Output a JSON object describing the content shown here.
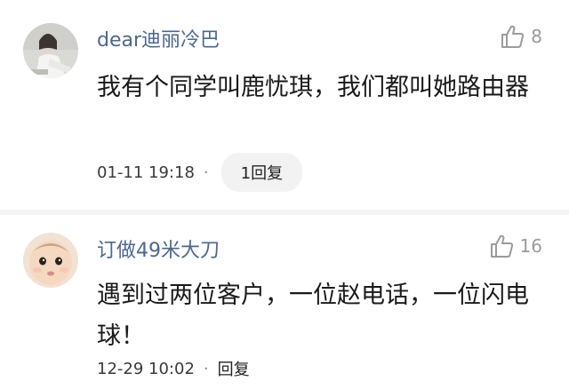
{
  "comments": [
    {
      "username": "dear迪丽冷巴",
      "likes": "8",
      "text": "我有个同学叫鹿忧琪，我们都叫她路由器",
      "timestamp": "01-11 19:18",
      "reply_label": "1回复",
      "avatar_icon": "user-avatar-girl"
    },
    {
      "username": "订做49米大刀",
      "likes": "16",
      "text": "遇到过两位客户，一位赵电话，一位闪电球！",
      "timestamp": "12-29 10:02",
      "reply_label": "回复",
      "avatar_icon": "user-avatar-baby"
    }
  ],
  "separator": "·",
  "colors": {
    "username": "#4a6795",
    "text": "#1a1a1a",
    "meta": "#3a3a3a",
    "like": "#9b9b9b",
    "reply_pill_bg": "#f2f2f2"
  }
}
